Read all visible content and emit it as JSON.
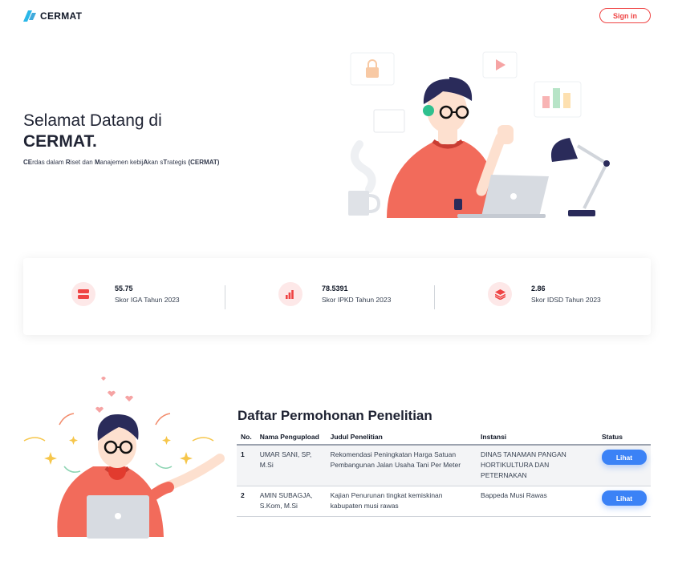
{
  "header": {
    "brand": "CERMAT",
    "signin_label": "Sign in"
  },
  "hero": {
    "title_line1": "Selamat Datang di",
    "title_line2": "CERMAT.",
    "subtitle_parts": [
      {
        "text": "CE",
        "bold": true
      },
      {
        "text": "rdas dalam ",
        "bold": false
      },
      {
        "text": "R",
        "bold": true
      },
      {
        "text": "iset dan ",
        "bold": false
      },
      {
        "text": "M",
        "bold": true
      },
      {
        "text": "anajemen kebij",
        "bold": false
      },
      {
        "text": "A",
        "bold": true
      },
      {
        "text": "kan s",
        "bold": false
      },
      {
        "text": "T",
        "bold": true
      },
      {
        "text": "rategis ",
        "bold": false
      },
      {
        "text": "(CERMAT)",
        "bold": true
      }
    ]
  },
  "stats": [
    {
      "value": "55.75",
      "label": "Skor IGA Tahun 2023",
      "icon": "server-icon"
    },
    {
      "value": "78.5391",
      "label": "Skor IPKD Tahun 2023",
      "icon": "bar-chart-icon"
    },
    {
      "value": "2.86",
      "label": "Skor IDSD Tahun 2023",
      "icon": "layers-icon"
    }
  ],
  "table": {
    "title": "Daftar Permohonan Penelitian",
    "headers": [
      "No.",
      "Nama Pengupload",
      "Judul Penelitian",
      "Instansi",
      "Status"
    ],
    "rows": [
      {
        "no": "1",
        "nama": "UMAR SANI, SP, M.Si",
        "judul": "Rekomendasi Peningkatan Harga Satuan Pembangunan Jalan Usaha Tani Per Meter",
        "instansi": "DINAS TANAMAN PANGAN HORTIKULTURA DAN PETERNAKAN",
        "status": "Lihat"
      },
      {
        "no": "2",
        "nama": "AMIN SUBAGJA, S.Kom, M.Si",
        "judul": "Kajian Penurunan tingkat kemiskinan kabupaten musi rawas",
        "instansi": "Bappeda Musi Rawas",
        "status": "Lihat"
      }
    ]
  },
  "colors": {
    "accent_red": "#ef4444",
    "brand_blue": "#2ab7e8",
    "button_blue": "#3b82f6",
    "shirt": "#f26b5b"
  }
}
